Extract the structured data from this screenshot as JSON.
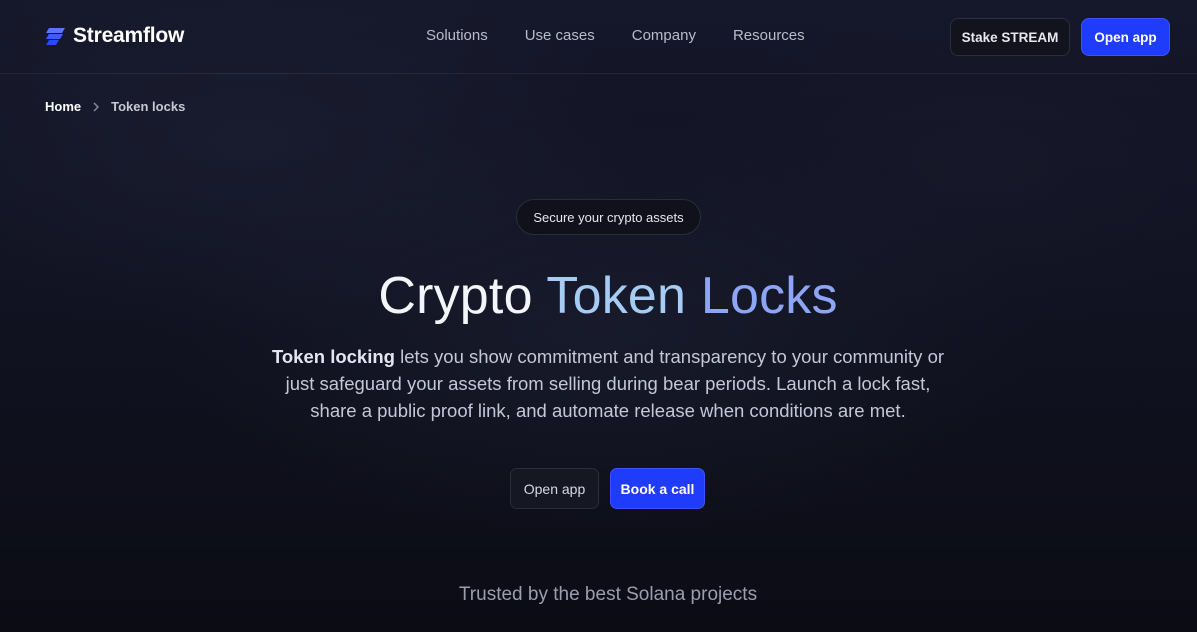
{
  "header": {
    "logo_text": "Streamflow",
    "nav": [
      "Solutions",
      "Use cases",
      "Company",
      "Resources"
    ],
    "stake_label": "Stake STREAM",
    "open_app_label": "Open app"
  },
  "breadcrumb": {
    "home": "Home",
    "separator": ">",
    "current": "Token locks"
  },
  "hero": {
    "pill": "Secure your crypto assets",
    "title_words": [
      "Crypto",
      "Token",
      "Locks"
    ],
    "desc_bold": "Token locking",
    "desc_rest": " lets you show commitment and transparency to your community or just safeguard your assets from selling during bear periods. Launch a lock fast, share a public proof link, and automate release when conditions are met.",
    "open_app_label": "Open app",
    "book_call_label": "Book a call"
  },
  "trusted": "Trusted by the best Solana projects",
  "colors": {
    "accent": "#1f3cfb",
    "title_gradient_start": "#a6ccf3",
    "title_gradient_end": "#8da5f4"
  }
}
